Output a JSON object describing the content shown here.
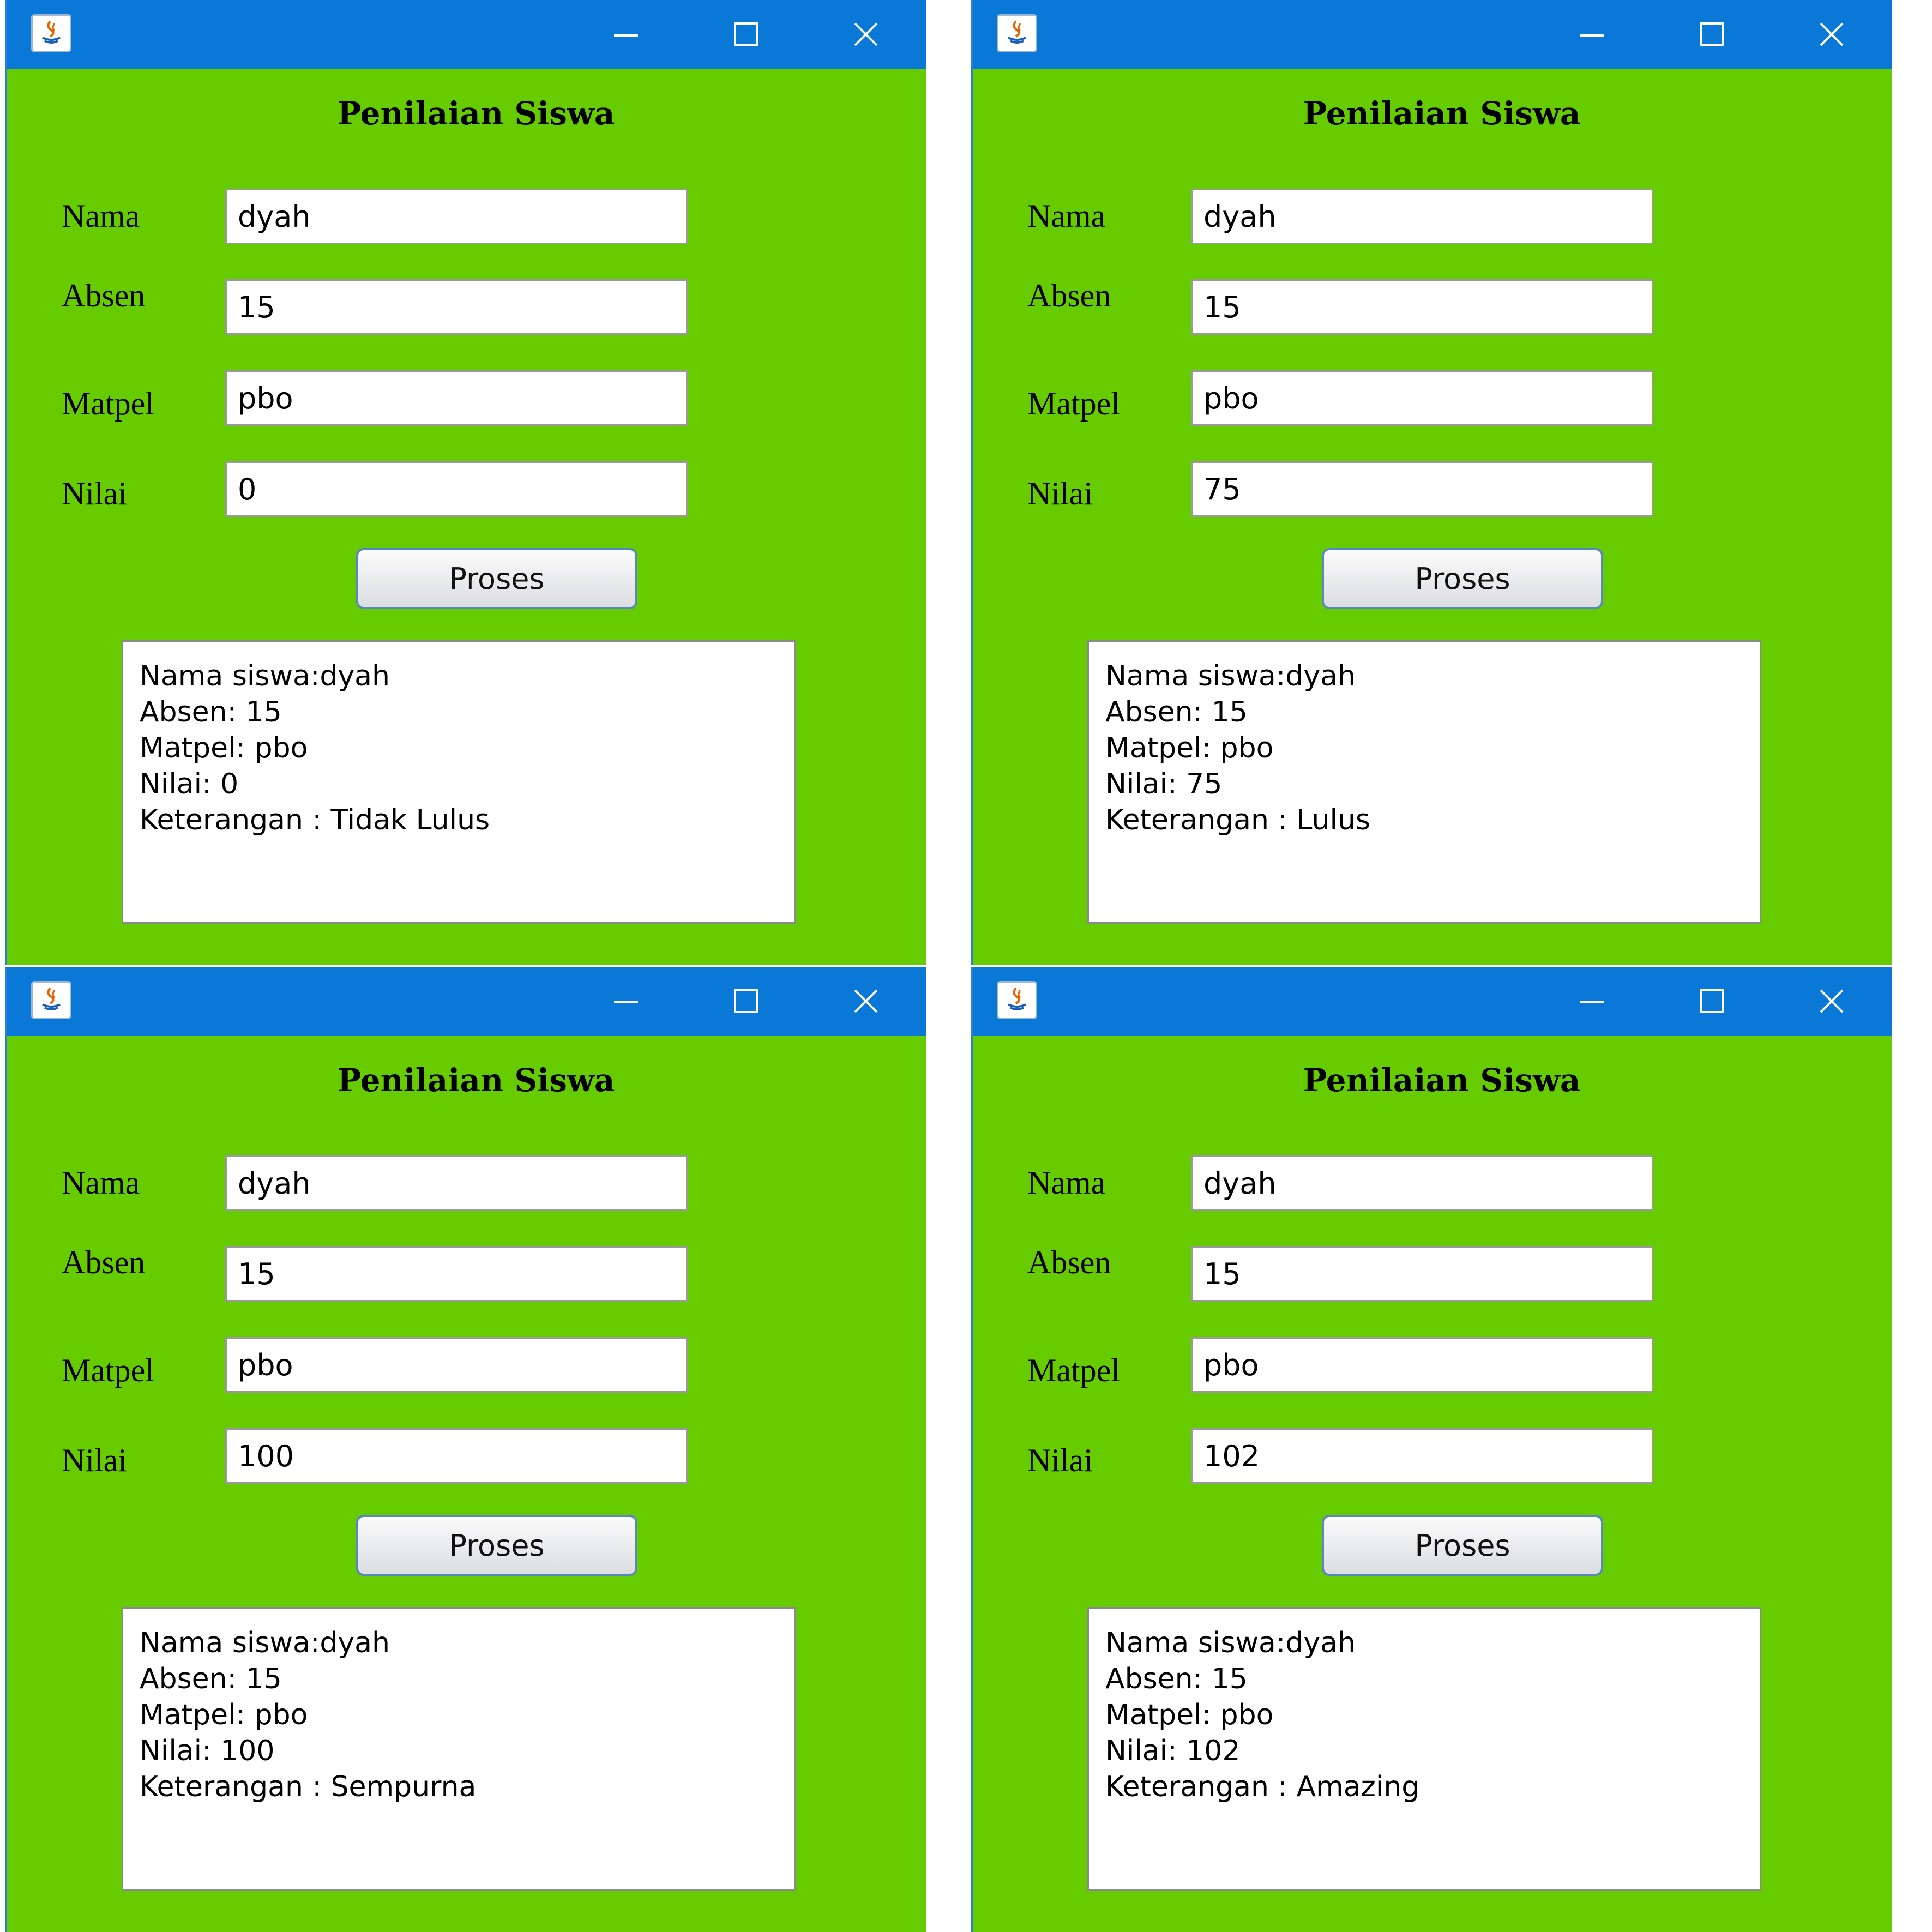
{
  "colors": {
    "titlebar": "#0a78d7",
    "form_background": "#66cc00"
  },
  "windows": [
    {
      "title_icon": "java-app-icon",
      "heading": "Penilaian Siswa",
      "labels": {
        "nama": "Nama",
        "absen": "Absen",
        "matpel": "Matpel",
        "nilai": "Nilai"
      },
      "fields": {
        "nama": "dyah",
        "absen": "15",
        "matpel": "pbo",
        "nilai": "0"
      },
      "button": "Proses",
      "output": [
        "Nama siswa:dyah",
        "Absen: 15",
        "Matpel: pbo",
        "Nilai: 0",
        "Keterangan : Tidak Lulus"
      ]
    },
    {
      "title_icon": "java-app-icon",
      "heading": "Penilaian Siswa",
      "labels": {
        "nama": "Nama",
        "absen": "Absen",
        "matpel": "Matpel",
        "nilai": "Nilai"
      },
      "fields": {
        "nama": "dyah",
        "absen": "15",
        "matpel": "pbo",
        "nilai": "75"
      },
      "button": "Proses",
      "output": [
        "Nama siswa:dyah",
        "Absen: 15",
        "Matpel: pbo",
        "Nilai: 75",
        "Keterangan : Lulus"
      ]
    },
    {
      "title_icon": "java-app-icon",
      "heading": "Penilaian Siswa",
      "labels": {
        "nama": "Nama",
        "absen": "Absen",
        "matpel": "Matpel",
        "nilai": "Nilai"
      },
      "fields": {
        "nama": "dyah",
        "absen": "15",
        "matpel": "pbo",
        "nilai": "100"
      },
      "button": "Proses",
      "output": [
        "Nama siswa:dyah",
        "Absen: 15",
        "Matpel: pbo",
        "Nilai: 100",
        "Keterangan : Sempurna"
      ]
    },
    {
      "title_icon": "java-app-icon",
      "heading": "Penilaian Siswa",
      "labels": {
        "nama": "Nama",
        "absen": "Absen",
        "matpel": "Matpel",
        "nilai": "Nilai"
      },
      "fields": {
        "nama": "dyah",
        "absen": "15",
        "matpel": "pbo",
        "nilai": "102"
      },
      "button": "Proses",
      "output": [
        "Nama siswa:dyah",
        "Absen: 15",
        "Matpel: pbo",
        "Nilai: 102",
        "Keterangan : Amazing"
      ]
    }
  ]
}
